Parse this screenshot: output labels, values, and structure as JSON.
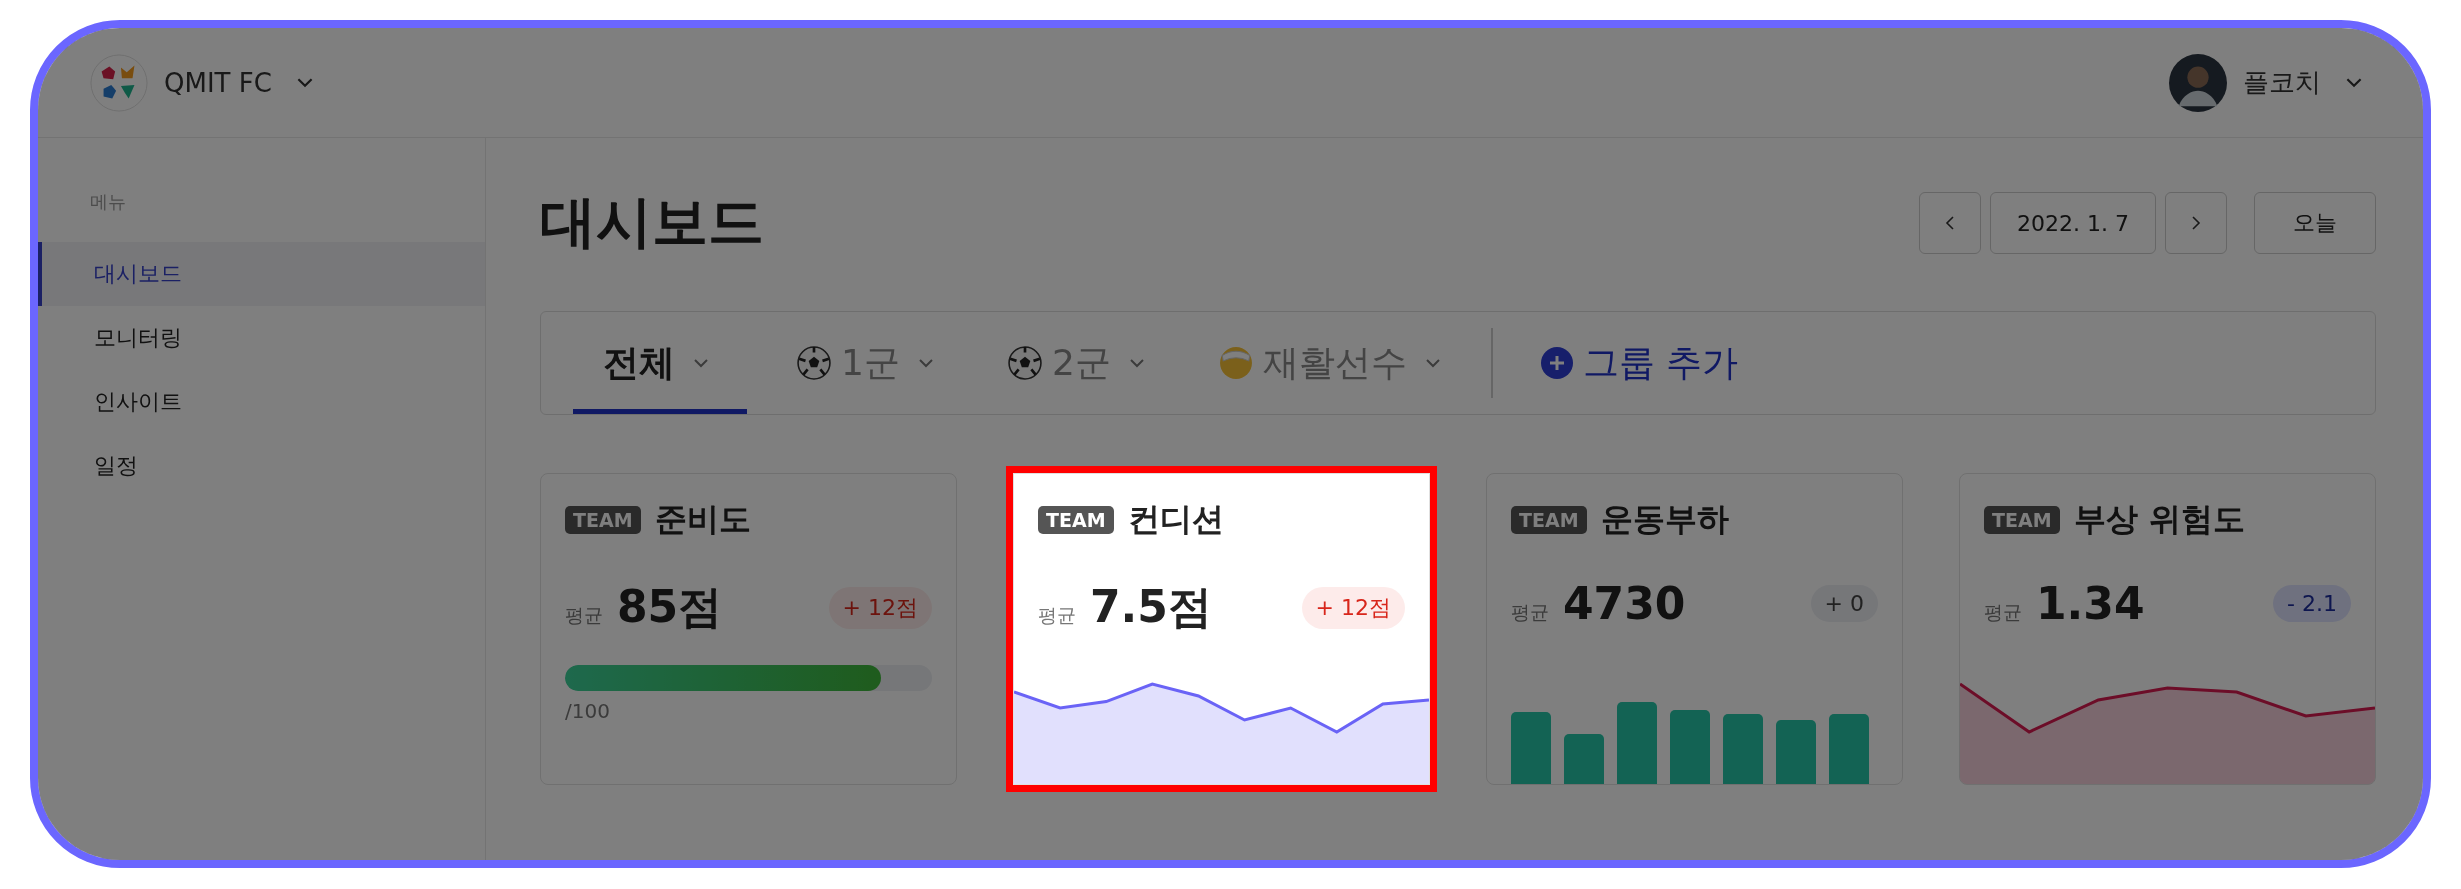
{
  "header": {
    "team": "QMIT FC",
    "user": "플코치"
  },
  "sidebar": {
    "heading": "메뉴",
    "items": [
      {
        "label": "대시보드",
        "selected": true
      },
      {
        "label": "모니터링",
        "selected": false
      },
      {
        "label": "인사이트",
        "selected": false
      },
      {
        "label": "일정",
        "selected": false
      }
    ]
  },
  "page": {
    "title": "대시보드",
    "date": "2022. 1. 7",
    "today": "오늘"
  },
  "tabs": [
    {
      "label": "전체",
      "kind": "plain",
      "selected": true
    },
    {
      "label": "1군",
      "kind": "squad",
      "selected": false
    },
    {
      "label": "2군",
      "kind": "squad",
      "selected": false
    },
    {
      "label": "재활선수",
      "kind": "rehab",
      "selected": false
    }
  ],
  "add_group": "그룹 추가",
  "dimmed": true,
  "cards": [
    {
      "badge": "TEAM",
      "title": "준비도",
      "avg_label": "평균",
      "value": "85점",
      "delta": {
        "text": "+ 12점",
        "kind": "up"
      },
      "kind": "progress",
      "level": 0.86,
      "scale": "/100",
      "highlighted": false
    },
    {
      "badge": "TEAM",
      "title": "컨디션",
      "avg_label": "평균",
      "value": "7.5점",
      "delta": {
        "text": "+ 12점",
        "kind": "up"
      },
      "kind": "area",
      "highlighted": true
    },
    {
      "badge": "TEAM",
      "title": "운동부하",
      "avg_label": "평균",
      "value": "4730",
      "delta": {
        "text": "+ 0",
        "kind": "flat"
      },
      "kind": "bars",
      "highlighted": false
    },
    {
      "badge": "TEAM",
      "title": "부상 위험도",
      "avg_label": "평균",
      "value": "1.34",
      "delta": {
        "text": "- 2.1",
        "kind": "down"
      },
      "kind": "area",
      "highlighted": false
    }
  ]
}
